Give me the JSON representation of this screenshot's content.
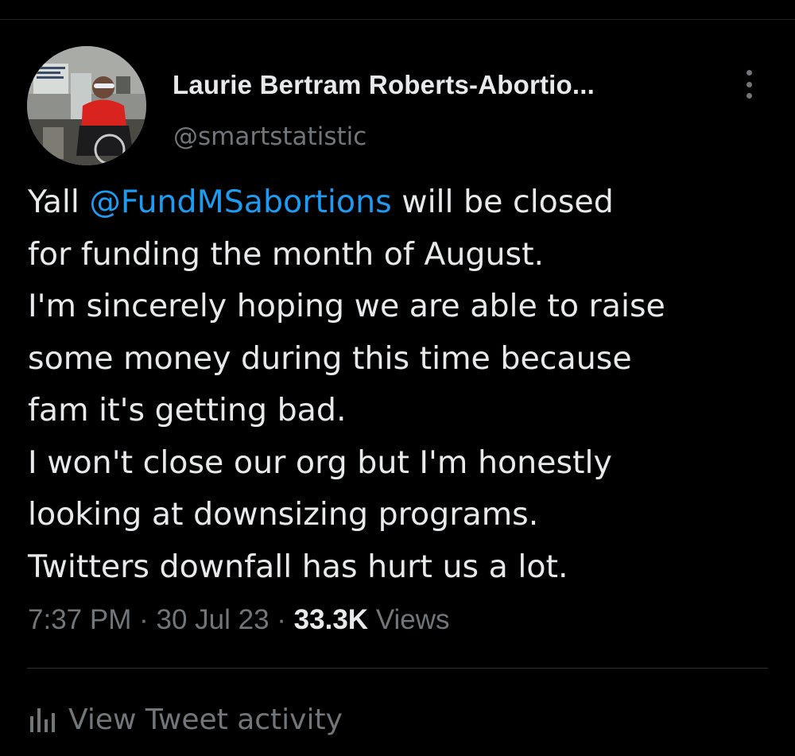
{
  "colors": {
    "background": "#000000",
    "primary_text": "#e7e9ea",
    "secondary_text": "#71767b",
    "link": "#1d9bf0",
    "divider": "#2f3336"
  },
  "tweet": {
    "author": {
      "display_name": "Laurie Bertram Roberts-Abortio...",
      "handle": "@smartstatistic",
      "avatar_icon": "profile-photo"
    },
    "more_icon": "more-vertical-icon",
    "lines": [
      {
        "before": "Yall ",
        "mention": "@FundMSabortions",
        "after": " will be closed"
      },
      {
        "text": "for funding the month of August."
      },
      {
        "text": "I'm sincerely hoping we are able to raise"
      },
      {
        "text": "some money during this time because"
      },
      {
        "text": "fam it's getting bad."
      },
      {
        "text": "I won't close our org but I'm honestly"
      },
      {
        "text": "looking at downsizing programs."
      },
      {
        "text": "Twitters downfall has hurt us a lot."
      }
    ],
    "meta": {
      "time": "7:37 PM",
      "separator": "·",
      "date": "30 Jul 23",
      "views_count": "33.3K",
      "views_label": "Views"
    },
    "activity": {
      "icon": "analytics-bars-icon",
      "label": "View Tweet activity"
    }
  }
}
